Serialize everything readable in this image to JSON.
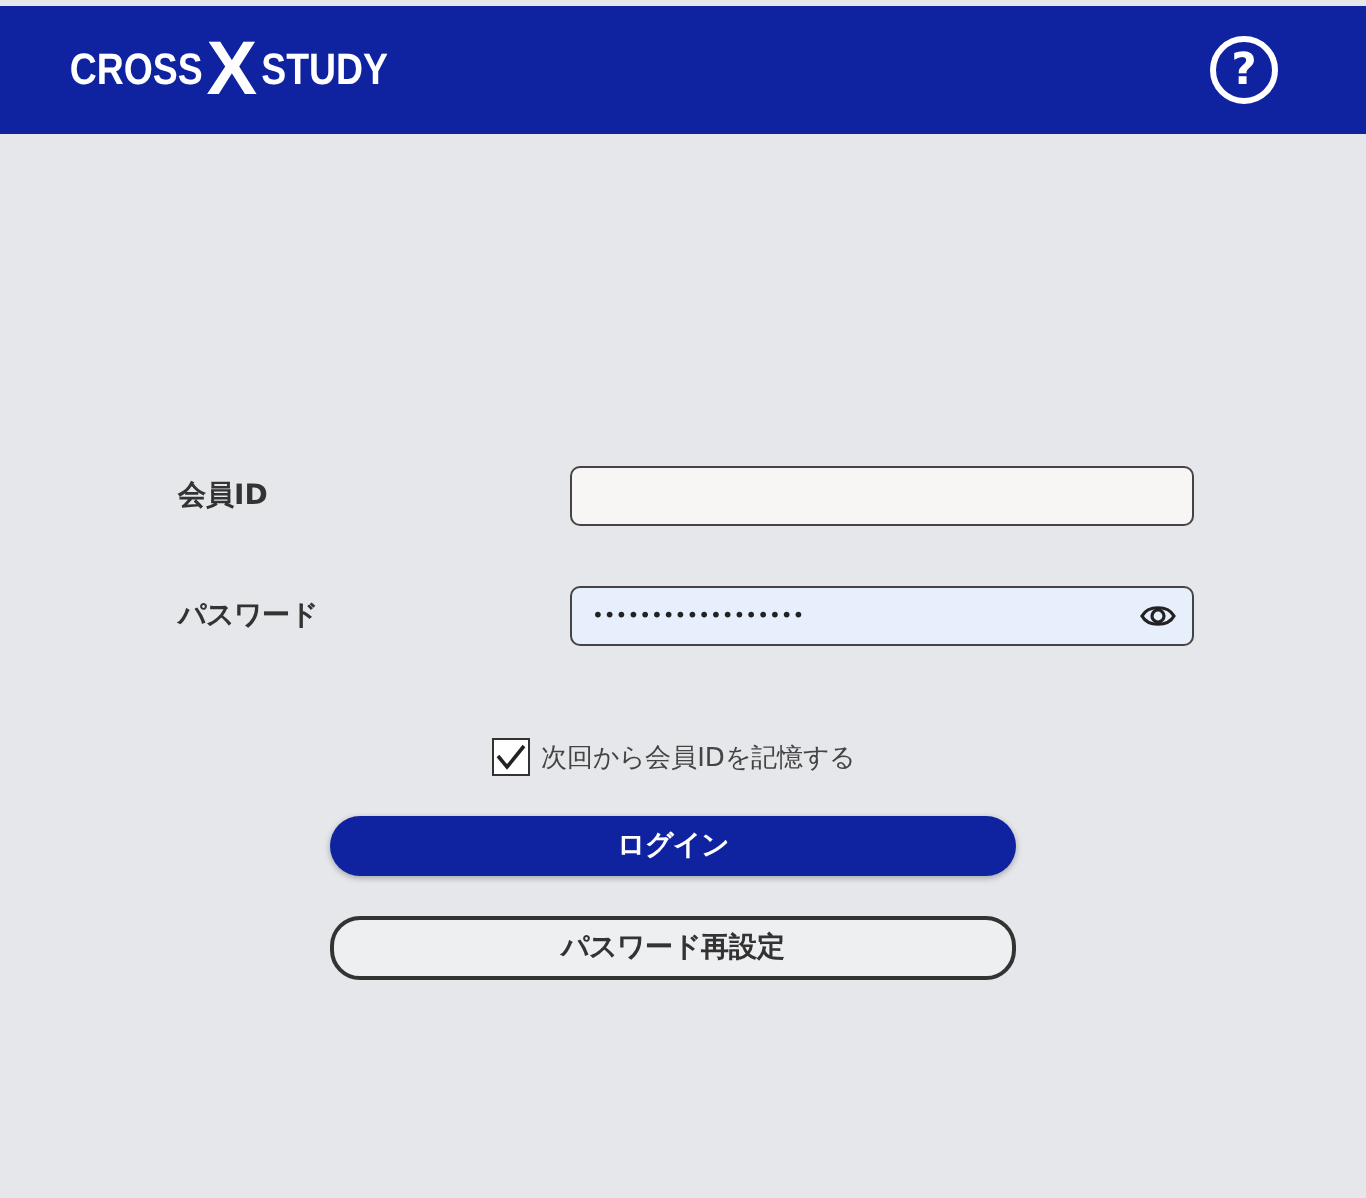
{
  "header": {
    "logo": [
      "CROSS",
      "X",
      "STUDY"
    ],
    "help": "?"
  },
  "fields": [
    {
      "label": "会員ID",
      "kind": "text",
      "focused": false
    },
    {
      "label": "パスワード",
      "kind": "password",
      "value": "••••••••••••••••••",
      "focused": true
    }
  ],
  "remember": {
    "label": "次回から会員IDを記憶する",
    "checked": true
  },
  "buttons": [
    {
      "label": "ログイン",
      "kind": "primary"
    },
    {
      "label": "パスワード再設定",
      "kind": "outline"
    }
  ]
}
